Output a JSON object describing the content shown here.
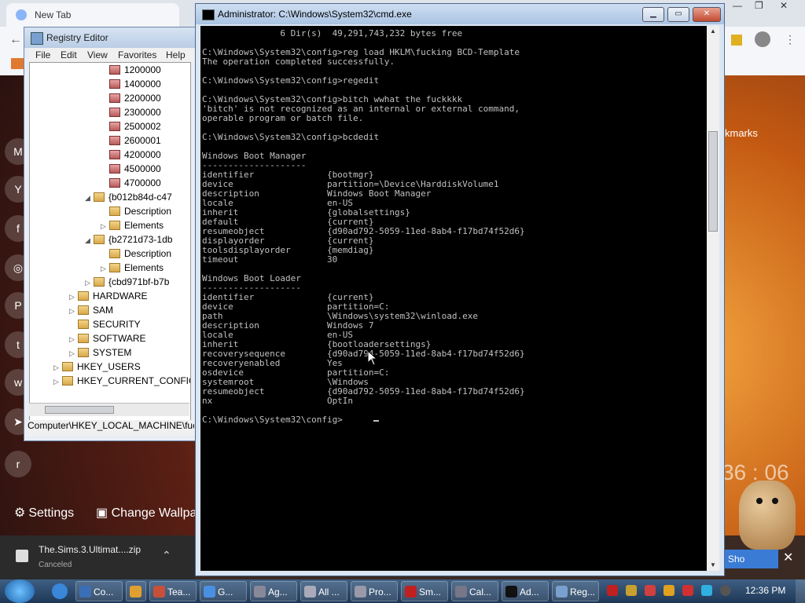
{
  "browser": {
    "tab_title": "New Tab",
    "bookmarks_label": "kmarks",
    "clock_overlay": "36 : 06",
    "settings_label": "Settings",
    "change_wallpaper_label": "Change Wallpa",
    "download": {
      "filename": "The.Sims.3.Ultimat....zip",
      "status": "Canceled"
    },
    "show_label": "Sho"
  },
  "registry": {
    "title": "Registry Editor",
    "menu": [
      "File",
      "Edit",
      "View",
      "Favorites",
      "Help"
    ],
    "tree": [
      {
        "label": "1200000",
        "indent": 3
      },
      {
        "label": "1400000",
        "indent": 3
      },
      {
        "label": "2200000",
        "indent": 3
      },
      {
        "label": "2300000",
        "indent": 3
      },
      {
        "label": "2500002",
        "indent": 3
      },
      {
        "label": "2600001",
        "indent": 3
      },
      {
        "label": "4200000",
        "indent": 3
      },
      {
        "label": "4500000",
        "indent": 3
      },
      {
        "label": "4700000",
        "indent": 3
      },
      {
        "label": "{b012b84d-c47",
        "indent": 2,
        "expander": "◢"
      },
      {
        "label": "Description",
        "indent": 3
      },
      {
        "label": "Elements",
        "indent": 3,
        "expander": "▷"
      },
      {
        "label": "{b2721d73-1db",
        "indent": 2,
        "expander": "◢"
      },
      {
        "label": "Description",
        "indent": 3
      },
      {
        "label": "Elements",
        "indent": 3,
        "expander": "▷"
      },
      {
        "label": "{cbd971bf-b7b",
        "indent": 2,
        "expander": "▷"
      },
      {
        "label": "HARDWARE",
        "indent": 1,
        "expander": "▷"
      },
      {
        "label": "SAM",
        "indent": 1,
        "expander": "▷"
      },
      {
        "label": "SECURITY",
        "indent": 1
      },
      {
        "label": "SOFTWARE",
        "indent": 1,
        "expander": "▷"
      },
      {
        "label": "SYSTEM",
        "indent": 1,
        "expander": "▷"
      },
      {
        "label": "HKEY_USERS",
        "indent": 0,
        "expander": "▷"
      },
      {
        "label": "HKEY_CURRENT_CONFIG",
        "indent": 0,
        "expander": "▷"
      }
    ],
    "status_path": "Computer\\HKEY_LOCAL_MACHINE\\fuc"
  },
  "cmd": {
    "title": "Administrator: C:\\Windows\\System32\\cmd.exe",
    "lines": [
      "               6 Dir(s)  49,291,743,232 bytes free",
      "",
      "C:\\Windows\\System32\\config>reg load HKLM\\fucking BCD-Template",
      "The operation completed successfully.",
      "",
      "C:\\Windows\\System32\\config>regedit",
      "",
      "C:\\Windows\\System32\\config>bitch wwhat the fuckkkk",
      "'bitch' is not recognized as an internal or external command,",
      "operable program or batch file.",
      "",
      "C:\\Windows\\System32\\config>bcdedit",
      "",
      "Windows Boot Manager",
      "--------------------",
      "identifier              {bootmgr}",
      "device                  partition=\\Device\\HarddiskVolume1",
      "description             Windows Boot Manager",
      "locale                  en-US",
      "inherit                 {globalsettings}",
      "default                 {current}",
      "resumeobject            {d90ad792-5059-11ed-8ab4-f17bd74f52d6}",
      "displayorder            {current}",
      "toolsdisplayorder       {memdiag}",
      "timeout                 30",
      "",
      "Windows Boot Loader",
      "-------------------",
      "identifier              {current}",
      "device                  partition=C:",
      "path                    \\Windows\\system32\\winload.exe",
      "description             Windows 7",
      "locale                  en-US",
      "inherit                 {bootloadersettings}",
      "recoverysequence        {d90ad794-5059-11ed-8ab4-f17bd74f52d6}",
      "recoveryenabled         Yes",
      "osdevice                partition=C:",
      "systemroot              \\Windows",
      "resumeobject            {d90ad792-5059-11ed-8ab4-f17bd74f52d6}",
      "nx                      OptIn",
      "",
      "C:\\Windows\\System32\\config>"
    ]
  },
  "taskbar": {
    "buttons": [
      {
        "label": "Co...",
        "color": "#3b6fb5"
      },
      {
        "label": "",
        "color": "#e0a030"
      },
      {
        "label": "Tea...",
        "color": "#c8503a"
      },
      {
        "label": "G...",
        "color": "#4a90e2"
      },
      {
        "label": "Ag...",
        "color": "#889"
      },
      {
        "label": "All ...",
        "color": "#aab"
      },
      {
        "label": "Pro...",
        "color": "#99a"
      },
      {
        "label": "Sm...",
        "color": "#c02020"
      },
      {
        "label": "Cal...",
        "color": "#778"
      },
      {
        "label": "Ad...",
        "color": "#111"
      },
      {
        "label": "Reg...",
        "color": "#7aa0d0"
      }
    ],
    "clock": "12:36 PM"
  }
}
